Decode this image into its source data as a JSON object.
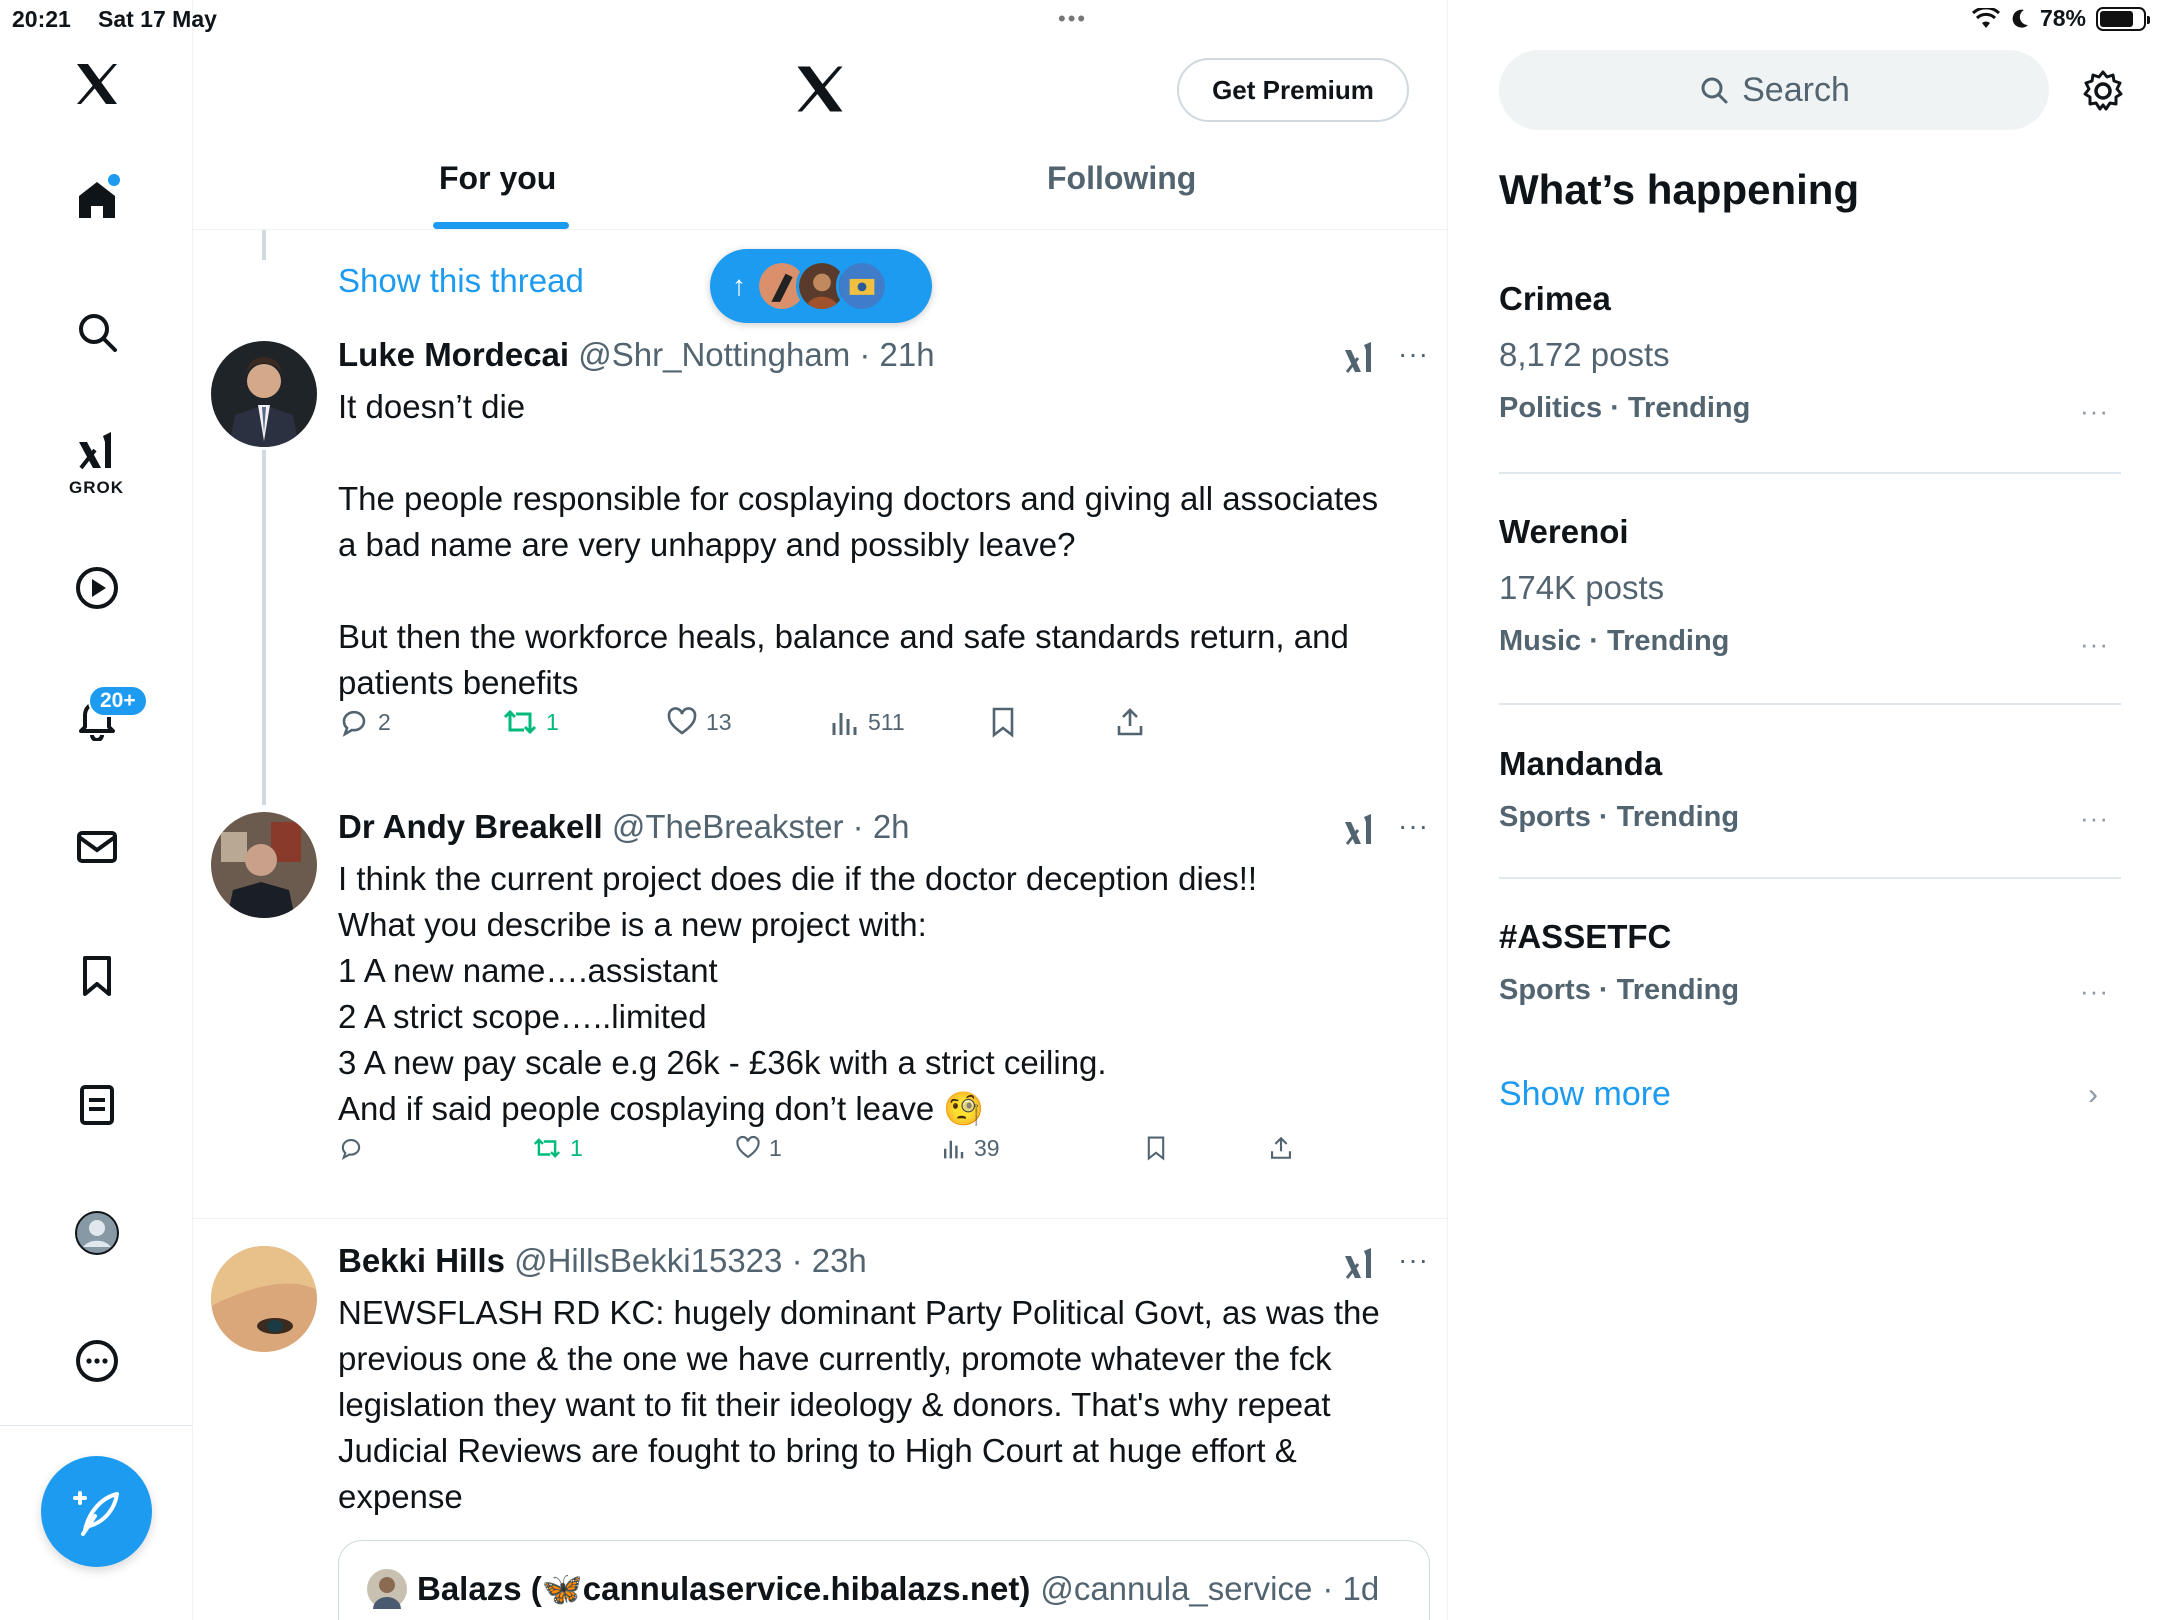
{
  "status_bar": {
    "time": "20:21",
    "date": "Sat 17 May",
    "battery": "78%",
    "battery_level": 0.78,
    "dots": "•••"
  },
  "nav": {
    "grok_label": "GROK",
    "notifications_badge": "20+"
  },
  "header": {
    "premium_label": "Get Premium",
    "tabs": [
      {
        "label": "For you",
        "active": true
      },
      {
        "label": "Following",
        "active": false
      }
    ]
  },
  "feed": {
    "show_thread": "Show this thread",
    "new_posts_arrow": "↑",
    "posts": [
      {
        "name": "Luke Mordecai",
        "handle": "@Shr_Nottingham",
        "time": "· 21h",
        "text": "It doesn’t die\n\nThe people responsible for cosplaying doctors and giving all associates a bad name are very unhappy and possibly leave?\n\nBut then the workforce heals, balance and safe standards return, and patients benefits",
        "replies": "2",
        "reposts": "1",
        "likes": "13",
        "views": "511"
      },
      {
        "name": "Dr Andy Breakell",
        "handle": "@TheBreakster",
        "time": "· 2h",
        "text": "I think the current project does die if the doctor deception dies!!\nWhat you describe is a new project with:\n1 A new name….assistant\n2 A strict scope…..limited\n3 A new pay scale e.g  26k - £36k with a strict ceiling.\nAnd if said people cosplaying don’t leave 🧐",
        "replies": "",
        "reposts": "1",
        "likes": "1",
        "views": "39"
      },
      {
        "name": "Bekki Hills",
        "handle": "@HillsBekki15323",
        "time": "· 23h",
        "text": "NEWSFLASH RD KC: hugely dominant Party Political Govt, as was the previous one & the one we have currently, promote whatever the fck legislation they want to fit their ideology & donors. That's why repeat Judicial Reviews are fought to bring to High Court at huge effort & expense",
        "quote": {
          "name": "Balazs (🦋cannulaservice.hibalazs.net)",
          "handle": "@cannula_service",
          "time": "· 1d"
        }
      }
    ],
    "more_dots": "···"
  },
  "sidebar": {
    "search_placeholder": "Search",
    "title": "What’s happening",
    "trends": [
      {
        "name": "Crimea",
        "posts": "8,172 posts",
        "meta": "Politics · Trending"
      },
      {
        "name": "Werenoi",
        "posts": "174K posts",
        "meta": "Music · Trending"
      },
      {
        "name": "Mandanda",
        "posts": "",
        "meta": "Sports · Trending"
      },
      {
        "name": "#ASSETFC",
        "posts": "",
        "meta": "Sports · Trending"
      }
    ],
    "show_more": "Show more",
    "chevron": "›",
    "more_dots": "···"
  },
  "colors": {
    "accent": "#1d9bf0",
    "repost": "#00ba7c",
    "muted": "#536471"
  }
}
